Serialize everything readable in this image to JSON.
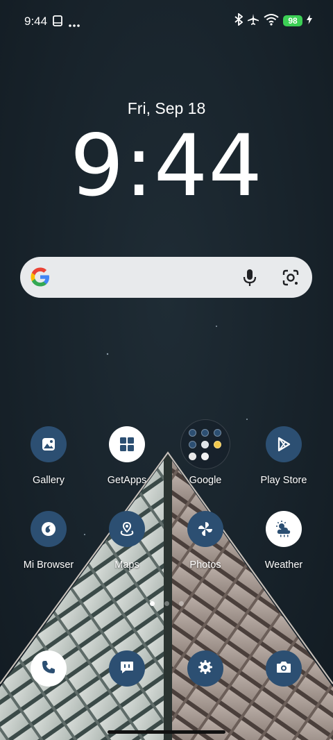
{
  "status_bar": {
    "time": "9:44",
    "battery": "98",
    "icons": [
      "screenshot-icon",
      "more-dots-icon",
      "bluetooth-icon",
      "airplane-icon",
      "wifi-icon",
      "battery-icon",
      "charging-icon"
    ]
  },
  "clock_widget": {
    "date": "Fri, Sep 18",
    "time": "9:44"
  },
  "search_bar": {
    "icons": [
      "google-logo-icon",
      "mic-icon",
      "lens-icon"
    ]
  },
  "apps": [
    {
      "label": "Gallery",
      "icon": "gallery-icon"
    },
    {
      "label": "GetApps",
      "icon": "getapps-icon"
    },
    {
      "label": "Google",
      "icon": "folder-icon"
    },
    {
      "label": "Play Store",
      "icon": "play-store-icon"
    },
    {
      "label": "Mi Browser",
      "icon": "browser-icon"
    },
    {
      "label": "Maps",
      "icon": "maps-icon"
    },
    {
      "label": "Photos",
      "icon": "photos-icon"
    },
    {
      "label": "Weather",
      "icon": "weather-icon"
    }
  ],
  "dock": [
    {
      "icon": "phone-icon"
    },
    {
      "icon": "messages-icon"
    },
    {
      "icon": "settings-icon"
    },
    {
      "icon": "camera-icon"
    }
  ],
  "page_indicator": {
    "pages": 3,
    "active": 1
  },
  "colors": {
    "icon_bg": "#2c4f72",
    "battery": "#3ccf55",
    "search_bg": "#e8eaec"
  }
}
